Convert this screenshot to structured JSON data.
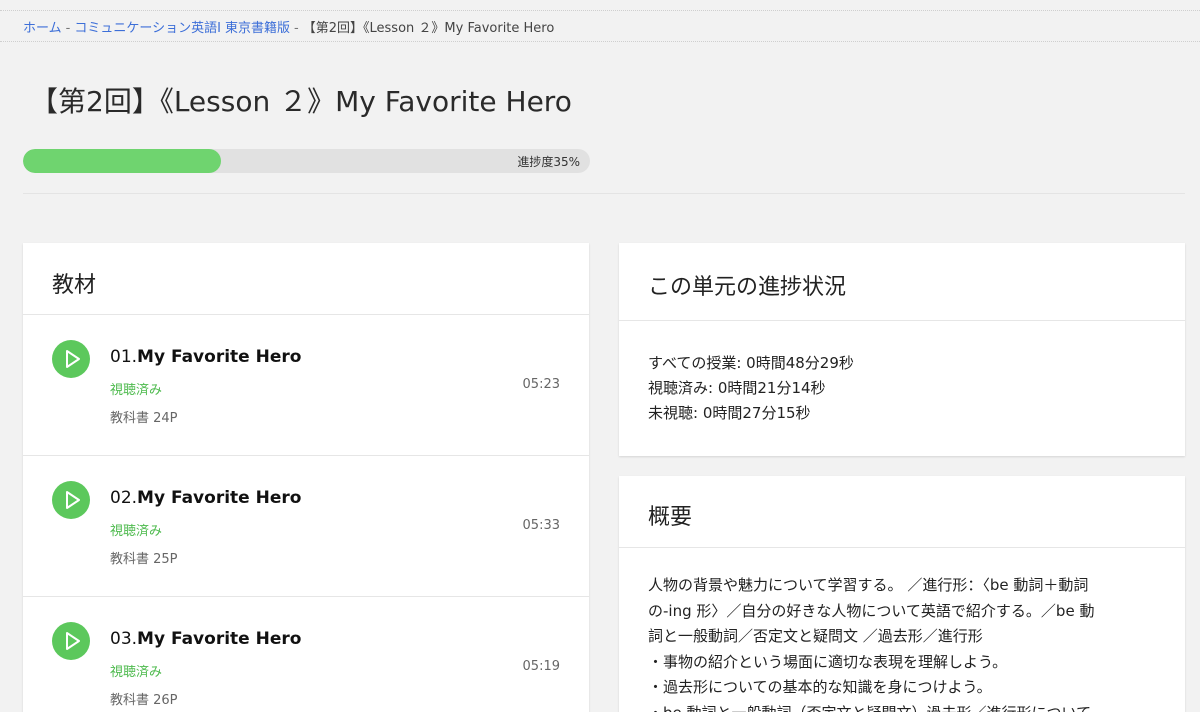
{
  "breadcrumb": {
    "home": "ホーム",
    "course": "コミュニケーション英語Ⅰ 東京書籍版",
    "current": "【第2回】《Lesson ２》My Favorite Hero",
    "separator": "-"
  },
  "page_title": "【第2回】《Lesson ２》My Favorite Hero",
  "progress": {
    "value": 35,
    "label": "進捗度35%",
    "color": "#6fd46f"
  },
  "materials": {
    "heading": "教材",
    "lessons": [
      {
        "number": "01.",
        "title": "My Favorite Hero",
        "status": "視聴済み",
        "duration": "05:23",
        "page": "教科書 24P"
      },
      {
        "number": "02.",
        "title": "My Favorite Hero",
        "status": "視聴済み",
        "duration": "05:33",
        "page": "教科書 25P"
      },
      {
        "number": "03.",
        "title": "My Favorite Hero",
        "status": "視聴済み",
        "duration": "05:19",
        "page": "教科書 26P"
      }
    ]
  },
  "unit_progress": {
    "heading": "この単元の進捗状況",
    "all": "すべての授業: 0時間48分29秒",
    "watched": "視聴済み: 0時間21分14秒",
    "unwatched": "未視聴: 0時間27分15秒"
  },
  "overview": {
    "heading": "概要",
    "lines": [
      "人物の背景や魅力について学習する。 ／進行形：〈be 動詞＋動詞",
      "の-ing 形〉／自分の好きな人物について英語で紹介する。／be 動",
      "詞と一般動詞／否定文と疑問文 ／過去形／進行形",
      "・事物の紹介という場面に適切な表現を理解しよう。",
      "・過去形についての基本的な知識を身につけよう。",
      "・be 動詞と一般動詞（否定文と疑問文）過去形／進行形について"
    ]
  },
  "icons": {
    "play": "play-icon"
  },
  "colors": {
    "accent_green": "#5cc85c",
    "link_blue": "#3d6fd8",
    "status_green": "#4dba4d"
  }
}
